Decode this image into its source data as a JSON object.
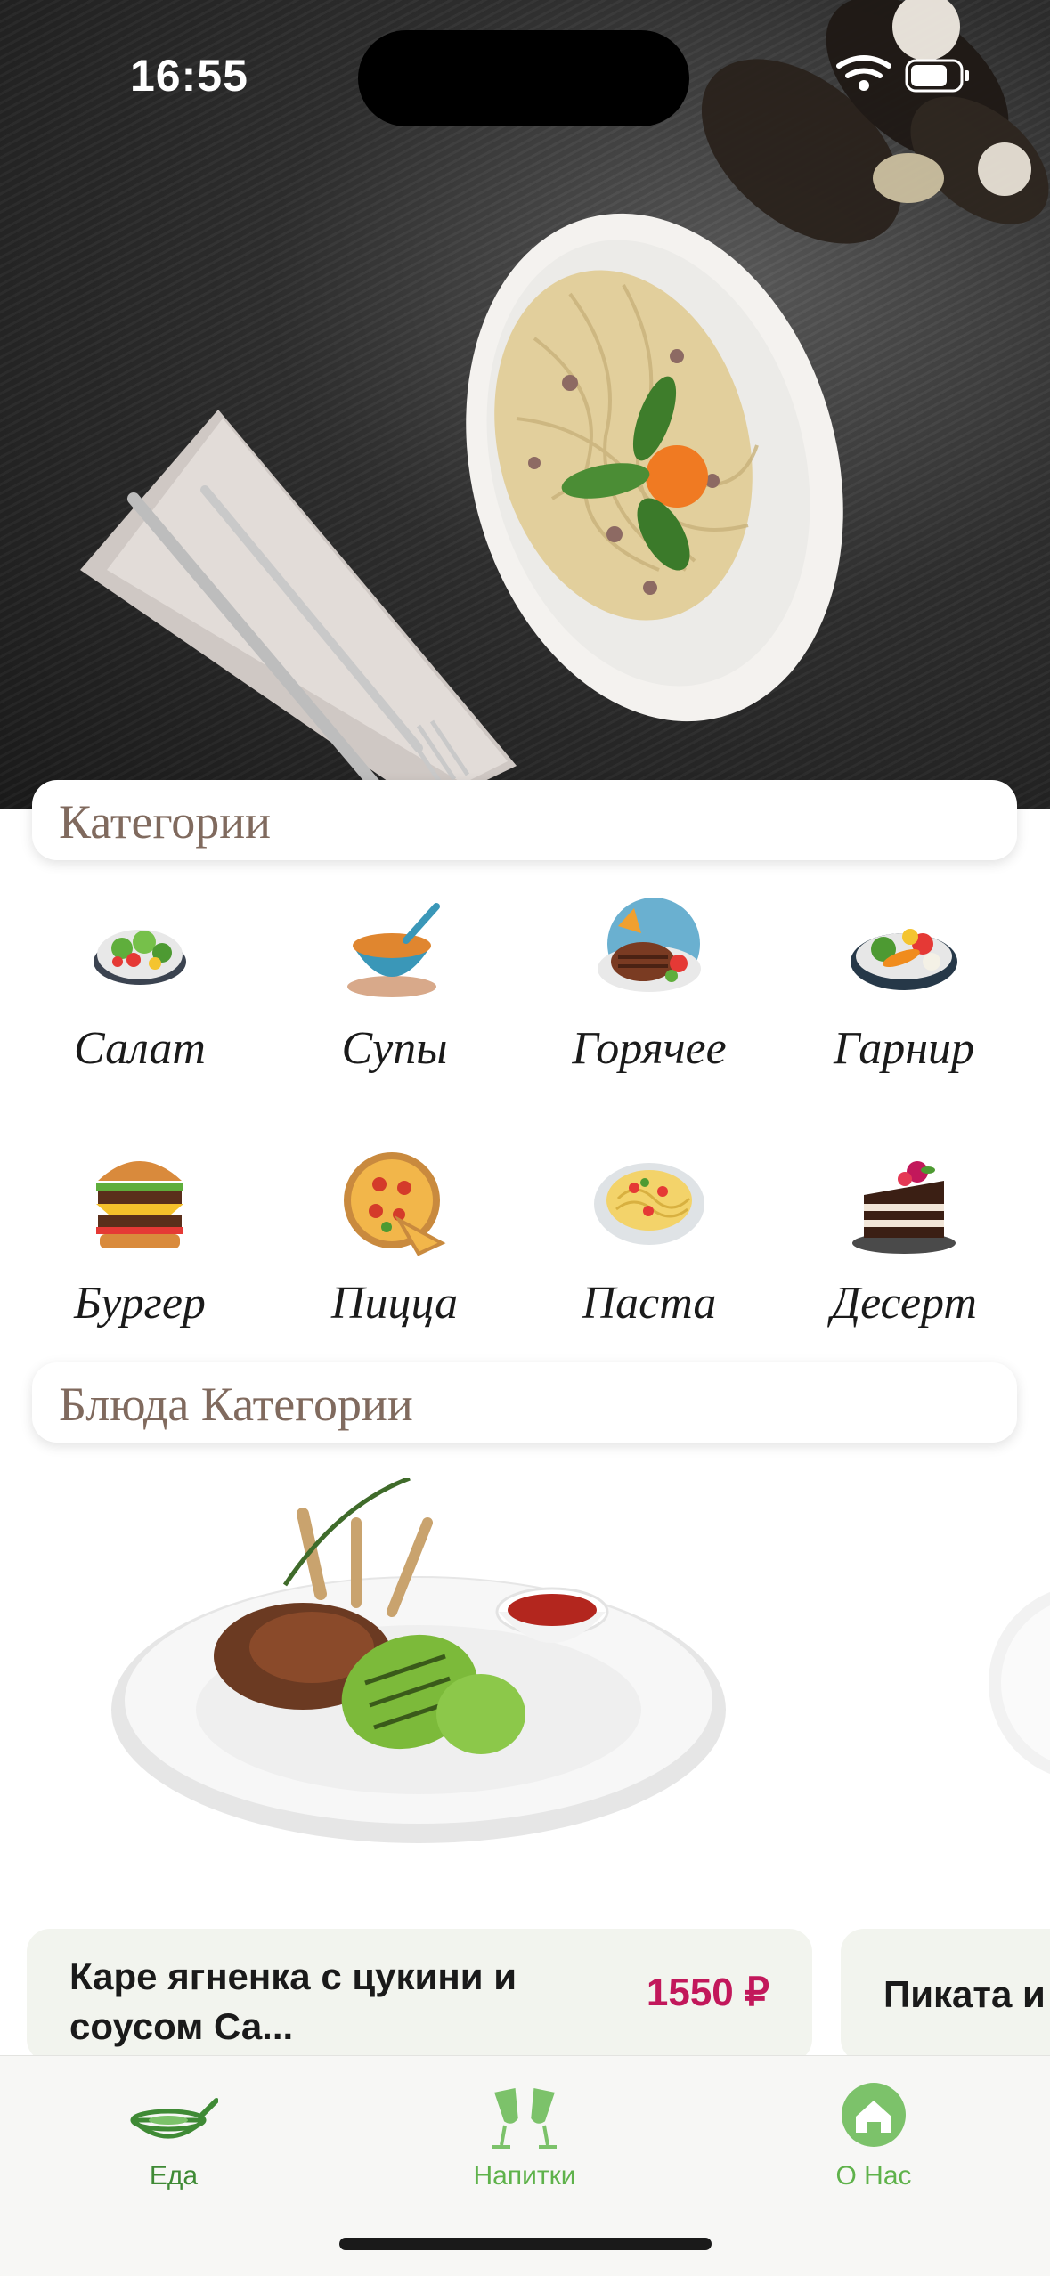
{
  "status_bar": {
    "time": "16:55"
  },
  "sections": {
    "categories_title": "Категории",
    "dishes_title": "Блюда Категории"
  },
  "categories": [
    {
      "label": "Салат",
      "icon": "salad-icon"
    },
    {
      "label": "Супы",
      "icon": "soup-icon"
    },
    {
      "label": "Горячее",
      "icon": "steak-icon"
    },
    {
      "label": "Гарнир",
      "icon": "vegetables-icon"
    },
    {
      "label": "Бургер",
      "icon": "burger-icon"
    },
    {
      "label": "Пицца",
      "icon": "pizza-icon"
    },
    {
      "label": "Паста",
      "icon": "pasta-icon"
    },
    {
      "label": "Десерт",
      "icon": "cake-icon"
    }
  ],
  "dishes": [
    {
      "name": "Каре ягненка с цукини и соусом Са...",
      "price": "1550 ₽"
    },
    {
      "name": "Пиката и"
    }
  ],
  "tabbar": {
    "tabs": [
      {
        "label": "Еда",
        "icon": "pan-icon",
        "active": true
      },
      {
        "label": "Напитки",
        "icon": "glasses-icon",
        "active": false
      },
      {
        "label": "О Нас",
        "icon": "home-icon",
        "active": false
      }
    ]
  },
  "colors": {
    "accent_green": "#5fb24b",
    "price": "#c2185b",
    "section_title": "#806a5e",
    "card_bg": "#f2f4ee"
  }
}
